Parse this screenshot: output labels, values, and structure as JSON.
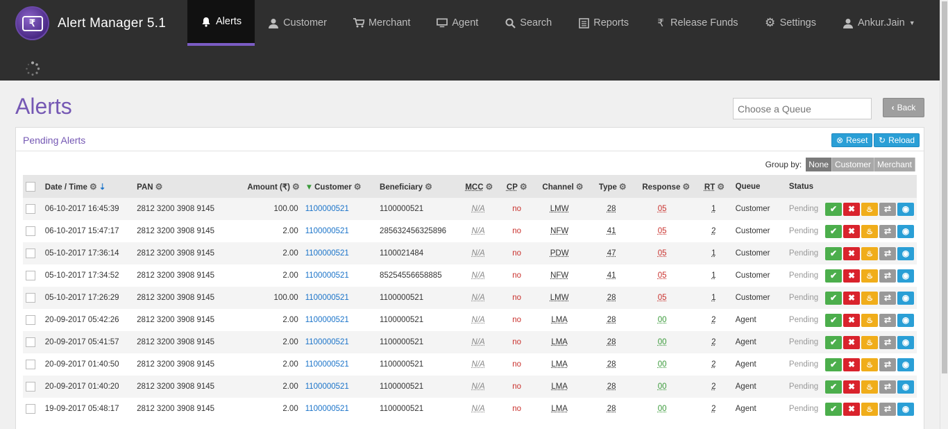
{
  "app": {
    "title": "Alert Manager 5.1",
    "logo_glyph": "₹"
  },
  "nav": [
    {
      "label": "Alerts",
      "icon": "bell-icon",
      "active": true
    },
    {
      "label": "Customer",
      "icon": "user-icon"
    },
    {
      "label": "Merchant",
      "icon": "cart-icon"
    },
    {
      "label": "Agent",
      "icon": "monitor-icon"
    },
    {
      "label": "Search",
      "icon": "search-icon"
    },
    {
      "label": "Reports",
      "icon": "list-icon"
    },
    {
      "label": "Release Funds",
      "icon": "rupee-icon"
    },
    {
      "label": "Settings",
      "icon": "gear-icon"
    },
    {
      "label": "Ankur.Jain",
      "icon": "user-icon"
    }
  ],
  "page": {
    "title": "Alerts",
    "queue_placeholder": "Choose a Queue",
    "back_label": "Back"
  },
  "panel": {
    "title": "Pending Alerts",
    "reset_label": "Reset",
    "reload_label": "Reload",
    "groupby_label": "Group by:",
    "groupby_options": [
      "None",
      "Customer",
      "Merchant"
    ],
    "groupby_selected": "None"
  },
  "columns": {
    "datetime": "Date / Time",
    "pan": "PAN",
    "amount": "Amount (₹)",
    "customer": "Customer",
    "beneficiary": "Beneficiary",
    "mcc": "MCC",
    "cp": "CP",
    "channel": "Channel",
    "type": "Type",
    "response": "Response",
    "rt": "RT",
    "queue": "Queue",
    "status": "Status"
  },
  "rows": [
    {
      "datetime": "06-10-2017 16:45:39",
      "pan": "2812 3200 3908 9145",
      "amount": "100.00",
      "customer": "1100000521",
      "beneficiary": "1100000521",
      "mcc": "N/A",
      "cp": "no",
      "channel": "LMW",
      "type": "28",
      "response": "05",
      "rt": "1",
      "queue": "Customer",
      "status": "Pending"
    },
    {
      "datetime": "06-10-2017 15:47:17",
      "pan": "2812 3200 3908 9145",
      "amount": "2.00",
      "customer": "1100000521",
      "beneficiary": "285632456325896",
      "mcc": "N/A",
      "cp": "no",
      "channel": "NFW",
      "type": "41",
      "response": "05",
      "rt": "2",
      "queue": "Customer",
      "status": "Pending"
    },
    {
      "datetime": "05-10-2017 17:36:14",
      "pan": "2812 3200 3908 9145",
      "amount": "2.00",
      "customer": "1100000521",
      "beneficiary": "1100021484",
      "mcc": "N/A",
      "cp": "no",
      "channel": "PDW",
      "type": "47",
      "response": "05",
      "rt": "1",
      "queue": "Customer",
      "status": "Pending"
    },
    {
      "datetime": "05-10-2017 17:34:52",
      "pan": "2812 3200 3908 9145",
      "amount": "2.00",
      "customer": "1100000521",
      "beneficiary": "85254556658885",
      "mcc": "N/A",
      "cp": "no",
      "channel": "NFW",
      "type": "41",
      "response": "05",
      "rt": "1",
      "queue": "Customer",
      "status": "Pending"
    },
    {
      "datetime": "05-10-2017 17:26:29",
      "pan": "2812 3200 3908 9145",
      "amount": "100.00",
      "customer": "1100000521",
      "beneficiary": "1100000521",
      "mcc": "N/A",
      "cp": "no",
      "channel": "LMW",
      "type": "28",
      "response": "05",
      "rt": "1",
      "queue": "Customer",
      "status": "Pending"
    },
    {
      "datetime": "20-09-2017 05:42:26",
      "pan": "2812 3200 3908 9145",
      "amount": "2.00",
      "customer": "1100000521",
      "beneficiary": "1100000521",
      "mcc": "N/A",
      "cp": "no",
      "channel": "LMA",
      "type": "28",
      "response": "00",
      "rt": "2",
      "queue": "Agent",
      "status": "Pending"
    },
    {
      "datetime": "20-09-2017 05:41:57",
      "pan": "2812 3200 3908 9145",
      "amount": "2.00",
      "customer": "1100000521",
      "beneficiary": "1100000521",
      "mcc": "N/A",
      "cp": "no",
      "channel": "LMA",
      "type": "28",
      "response": "00",
      "rt": "2",
      "queue": "Agent",
      "status": "Pending"
    },
    {
      "datetime": "20-09-2017 01:40:50",
      "pan": "2812 3200 3908 9145",
      "amount": "2.00",
      "customer": "1100000521",
      "beneficiary": "1100000521",
      "mcc": "N/A",
      "cp": "no",
      "channel": "LMA",
      "type": "28",
      "response": "00",
      "rt": "2",
      "queue": "Agent",
      "status": "Pending"
    },
    {
      "datetime": "20-09-2017 01:40:20",
      "pan": "2812 3200 3908 9145",
      "amount": "2.00",
      "customer": "1100000521",
      "beneficiary": "1100000521",
      "mcc": "N/A",
      "cp": "no",
      "channel": "LMA",
      "type": "28",
      "response": "00",
      "rt": "2",
      "queue": "Agent",
      "status": "Pending"
    },
    {
      "datetime": "19-09-2017 05:48:17",
      "pan": "2812 3200 3908 9145",
      "amount": "2.00",
      "customer": "1100000521",
      "beneficiary": "1100000521",
      "mcc": "N/A",
      "cp": "no",
      "channel": "LMA",
      "type": "28",
      "response": "00",
      "rt": "2",
      "queue": "Agent",
      "status": "Pending"
    }
  ],
  "colors": {
    "accent": "#7558b4",
    "nav_bg": "#2f2f2f",
    "link": "#1a73c9",
    "danger": "#c9302c",
    "ok": "#3a9a3a"
  }
}
